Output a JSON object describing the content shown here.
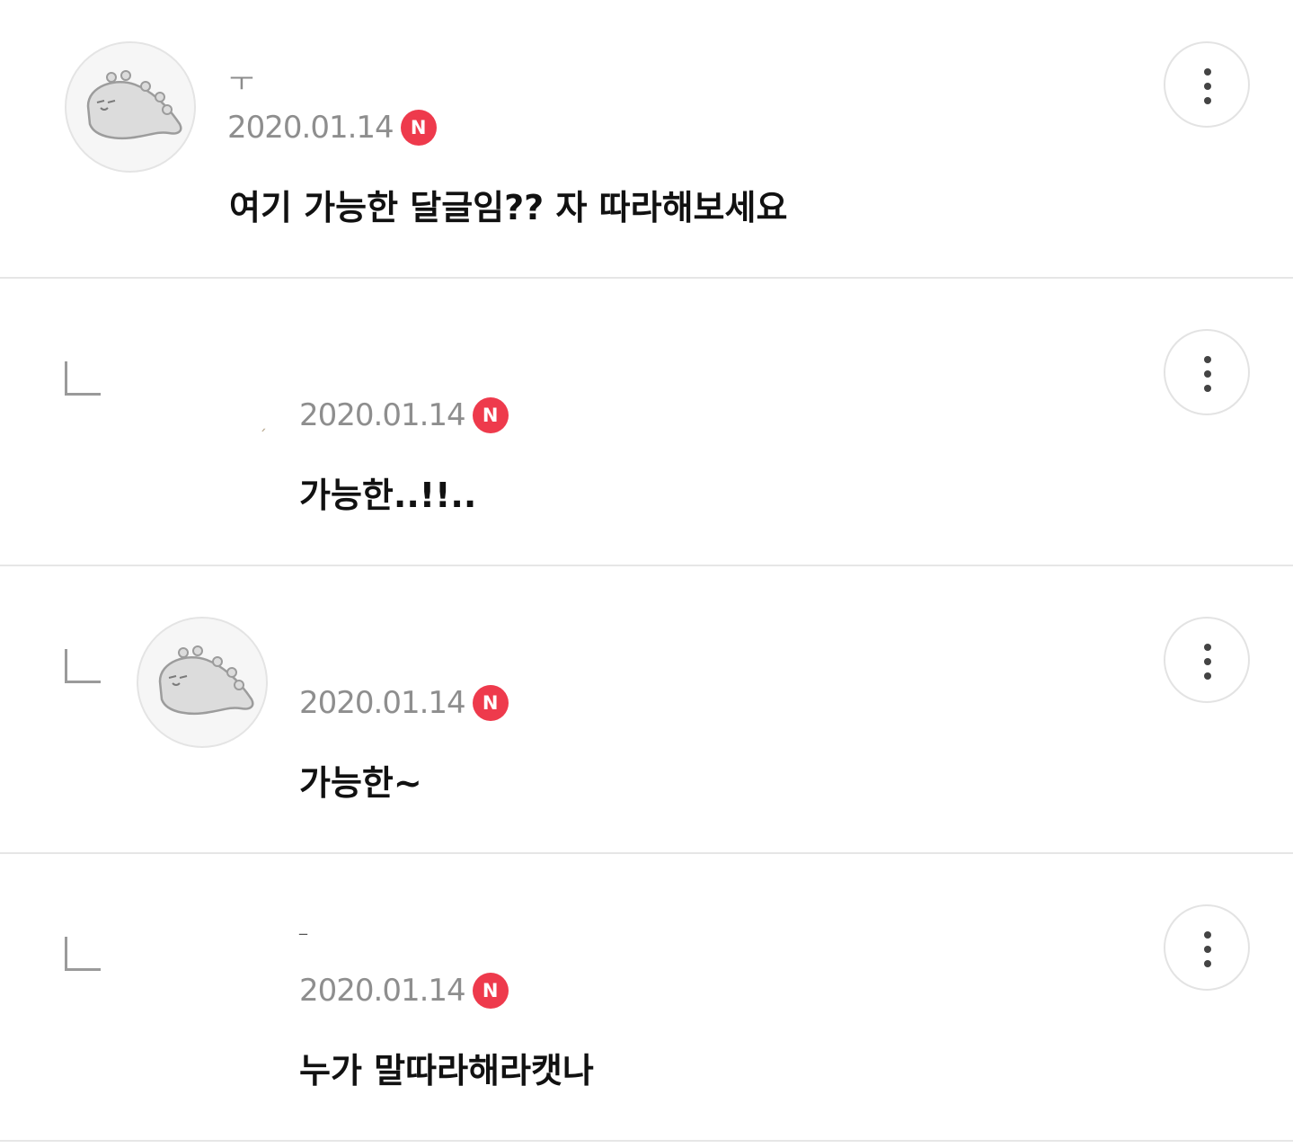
{
  "comments": [
    {
      "author": "ㅜ",
      "date": "2020.01.14",
      "badge": "N",
      "text": "여기 가능한 달글임?? 자 따라해보세요"
    },
    {
      "author": "",
      "date": "2020.01.14",
      "badge": "N",
      "text": "가능한..!!.."
    },
    {
      "author": "",
      "date": "2020.01.14",
      "badge": "N",
      "text": "가능한~"
    },
    {
      "author": "",
      "date": "2020.01.14",
      "badge": "N",
      "text": "누가 말따라해라캣나"
    }
  ],
  "icons": {
    "more": "more-vertical-icon",
    "reply": "reply-arrow-icon",
    "avatar": "dino-avatar-icon"
  },
  "colors": {
    "badge": "#ee3a4c",
    "date": "#8e8e8e",
    "text": "#111111",
    "divider": "#e6e6e6"
  }
}
